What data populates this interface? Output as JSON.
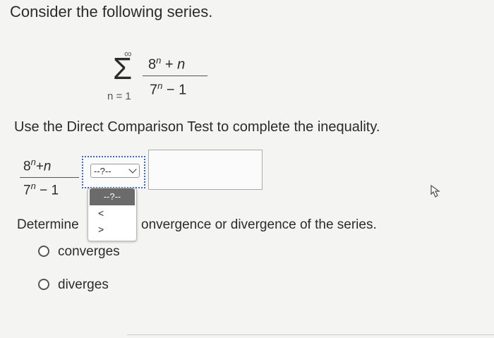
{
  "question": {
    "intro": "Consider the following series.",
    "series": {
      "upper_limit": "∞",
      "sum_symbol": "Σ",
      "lower_limit": "n = 1",
      "num_base": "8",
      "num_exp": "n",
      "num_rest": " + ",
      "num_var": "n",
      "den_base": "7",
      "den_exp": "n",
      "den_rest": " − 1"
    },
    "instruction": "Use the Direct Comparison Test to complete the inequality.",
    "inequality": {
      "num_base": "8",
      "num_exp": "n",
      "num_rest": "+",
      "num_var": "n",
      "den_base": "7",
      "den_exp": "n",
      "den_rest": " − 1",
      "select_value": "--?--",
      "answer_value": ""
    },
    "dropdown": {
      "header": "--?--",
      "options": [
        "<",
        ">"
      ]
    },
    "determine_left": "Determine",
    "determine_right": "onvergence or divergence of the series.",
    "radio_options": [
      "converges",
      "diverges"
    ]
  }
}
